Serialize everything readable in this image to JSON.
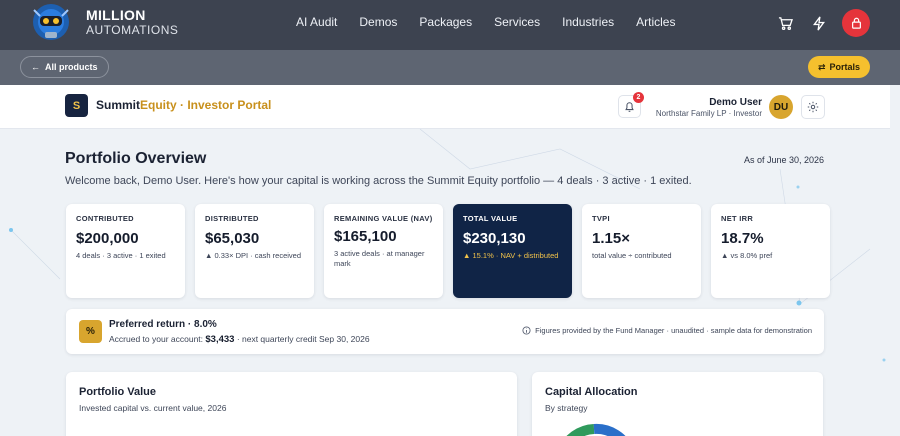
{
  "site": {
    "brand_line1": "MILLION",
    "brand_line2": "AUTOMATIONS",
    "nav": [
      "AI Audit",
      "Demos",
      "Packages",
      "Services",
      "Industries",
      "Articles"
    ]
  },
  "subbar": {
    "all_products": "All products",
    "portals": "Portals"
  },
  "app": {
    "logo_letter": "S",
    "title_main": "Summit",
    "title_accent": "Equity · Investor Portal",
    "notif_count": "2",
    "user_name": "Demo User",
    "user_sub": "Northstar Family LP · Investor",
    "avatar": "DU"
  },
  "overview": {
    "title": "Portfolio Overview",
    "as_of": "As of June 30, 2026",
    "subtitle": "Welcome back, Demo User. Here's how your capital is working across the Summit Equity portfolio — 4 deals · 3 active · 1 exited."
  },
  "kpis": [
    {
      "label": "CONTRIBUTED",
      "value": "$200,000",
      "note": "4 deals · 3 active · 1 exited"
    },
    {
      "label": "DISTRIBUTED",
      "value": "$65,030",
      "note": "▲ 0.33× DPI · cash received"
    },
    {
      "label": "REMAINING VALUE (NAV)",
      "value": "$165,100",
      "note": "3 active deals · at manager mark"
    },
    {
      "label": "TOTAL VALUE",
      "value": "$230,130",
      "note": "▲ 15.1% · NAV + distributed"
    },
    {
      "label": "TVPI",
      "value": "1.15×",
      "note": "total value ÷ contributed"
    },
    {
      "label": "NET IRR",
      "value": "18.7%",
      "note": "▲ vs 8.0% pref"
    }
  ],
  "pref": {
    "icon": "%",
    "title": "Preferred return · 8.0%",
    "line_pre": "Accrued to your account: ",
    "amount": "$3,433",
    "line_post": " · next quarterly credit Sep 30, 2026",
    "disclaimer": "Figures provided by the Fund Manager · unaudited · sample data for demonstration"
  },
  "cards": {
    "portfolio_title": "Portfolio Value",
    "portfolio_sub": "Invested capital vs. current value, 2026",
    "alloc_title": "Capital Allocation",
    "alloc_sub": "By strategy"
  },
  "colors": {
    "nav_bg": "#3d4350",
    "subbar_bg": "#5e6572",
    "accent_gold": "#d8a52e",
    "navy": "#102446",
    "alert_red": "#e5343b"
  }
}
